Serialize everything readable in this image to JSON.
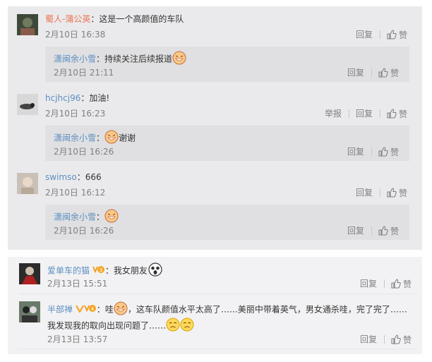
{
  "colors": {
    "panel_bg": "#eaeaec",
    "reply_bg": "#e0e0e2",
    "name": "#eb7350",
    "reply_name": "#5d8fc0",
    "muted": "#808080"
  },
  "threads": [
    {
      "name": "蜀人-蒲公英",
      "colon": "：",
      "text": "这是一个高颜值的车队",
      "time": "2月10日 16:38",
      "reply_label": "回复",
      "like_label": "赞",
      "reply": {
        "name": "潇闽余小雪",
        "colon": "：",
        "text": "持续关注后续报道",
        "emoji": "grin-emoji",
        "time": "2月10日 21:11",
        "reply_label": "回复",
        "like_label": "赞"
      }
    },
    {
      "name": "hcjhcj96",
      "colon": "：",
      "text": "加油!",
      "time": "2月10日 16:23",
      "report_label": "举报",
      "reply_label": "回复",
      "like_label": "赞",
      "reply": {
        "name": "潇闽余小雪",
        "colon": "：",
        "text": "谢谢",
        "emoji": "grin-emoji",
        "time": "2月10日 16:26",
        "reply_label": "回复",
        "like_label": "赞"
      }
    },
    {
      "name": "swimso",
      "colon": "：",
      "text": "666",
      "time": "2月10日 16:12",
      "reply_label": "回复",
      "like_label": "赞",
      "reply": {
        "name": "潇闽余小雪",
        "colon": "：",
        "text": "",
        "emoji": "grin-emoji",
        "time": "2月10日 16:26",
        "reply_label": "回复",
        "like_label": "赞"
      }
    }
  ],
  "comments": [
    {
      "name": "爱单车的猫",
      "colon": "：",
      "text": "我女朋友",
      "emoji": "shocked-emoji",
      "time": "2月13日 15:51",
      "reply_label": "回复",
      "like_label": "赞"
    },
    {
      "name": "半部禅",
      "colon": "：",
      "text_a": "哇",
      "text_b": "，这车队颜值水平太高了……美丽中带着英气，男女通杀哇，完了完了……",
      "text_c": "我发现我的取向出现问题了……",
      "time": "2月13日 13:57",
      "reply_label": "回复",
      "like_label": "赞"
    }
  ]
}
